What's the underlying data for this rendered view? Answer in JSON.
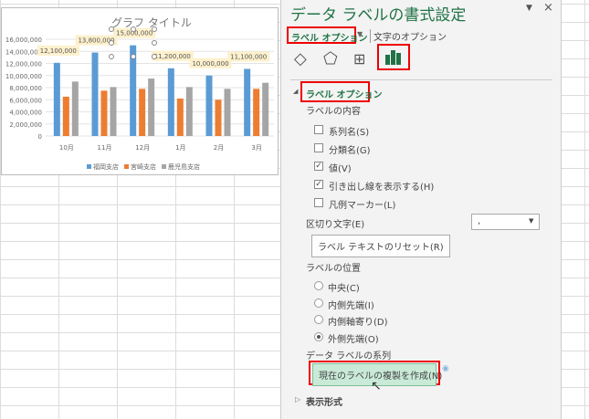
{
  "chart_data": {
    "type": "bar",
    "title": "グラフ タイトル",
    "categories": [
      "10月",
      "11月",
      "12月",
      "1月",
      "2月",
      "3月"
    ],
    "series": [
      {
        "name": "福岡支店",
        "color": "#5b9bd5",
        "values": [
          12100000,
          13800000,
          15000000,
          11200000,
          10000000,
          11100000
        ]
      },
      {
        "name": "宮崎支店",
        "color": "#ed7d31",
        "values": [
          6500000,
          7500000,
          7800000,
          6200000,
          6000000,
          7800000
        ]
      },
      {
        "name": "鹿児島支店",
        "color": "#a5a5a5",
        "values": [
          9000000,
          8100000,
          9500000,
          8100000,
          7800000,
          8800000
        ]
      }
    ],
    "data_labels": [
      "12,100,000",
      "13,800,000",
      "15,000,000",
      "11,200,000",
      "10,000,000",
      "11,100,000"
    ],
    "yticks": [
      "0",
      "2,000,000",
      "4,000,000",
      "6,000,000",
      "8,000,000",
      "10,000,000",
      "12,000,000",
      "14,000,000",
      "16,000,000"
    ],
    "ylim": [
      0,
      16000000
    ],
    "legend": "bottom"
  },
  "panel": {
    "title": "データ ラベルの書式設定",
    "tab_label_options": "ラベル オプション",
    "tab_text_options": "文字のオプション",
    "section": "ラベル オプション",
    "label_contents": "ラベルの内容",
    "checkboxes": [
      {
        "label": "系列名(S)",
        "checked": false
      },
      {
        "label": "分類名(G)",
        "checked": false
      },
      {
        "label": "値(V)",
        "checked": true
      },
      {
        "label": "引き出し線を表示する(H)",
        "checked": true
      },
      {
        "label": "凡例マーカー(L)",
        "checked": false
      }
    ],
    "separator_label": "区切り文字(E)",
    "separator_value": ",",
    "reset_button": "ラベル テキストのリセット(R)",
    "position_label": "ラベルの位置",
    "radios": [
      {
        "label": "中央(C)",
        "checked": false
      },
      {
        "label": "内側先端(I)",
        "checked": false
      },
      {
        "label": "内側軸寄り(D)",
        "checked": false
      },
      {
        "label": "外側先端(O)",
        "checked": true
      }
    ],
    "series_label": "データ ラベルの系列",
    "clone_button": "現在のラベルの複製を作成(N)",
    "number_section": "表示形式"
  }
}
